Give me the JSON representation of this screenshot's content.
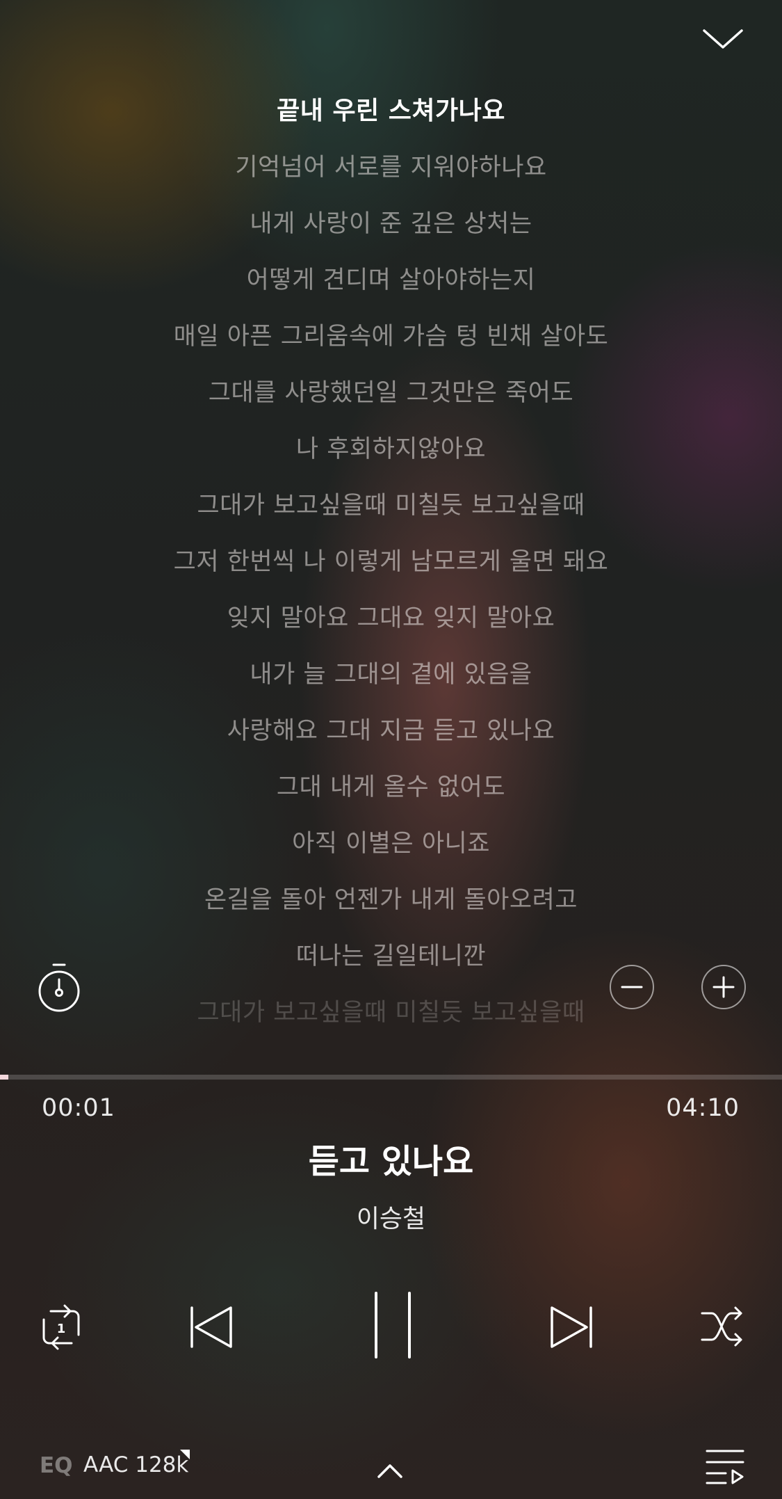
{
  "icons": {
    "collapse": "chevron-down-icon",
    "timer": "stopwatch-icon",
    "font_smaller": "minus-circle-icon",
    "font_larger": "plus-circle-icon",
    "repeat": "repeat-one-icon",
    "previous": "skip-previous-icon",
    "pause": "pause-icon",
    "next": "skip-next-icon",
    "shuffle": "shuffle-icon",
    "expand": "chevron-up-icon",
    "playlist": "playlist-icon"
  },
  "lyrics": {
    "lines": [
      "끝내 우린 스쳐가나요",
      "기억넘어 서로를 지워야하나요",
      "내게 사랑이 준 깊은 상처는",
      "어떻게 견디며 살아야하는지",
      "매일 아픈 그리움속에 가슴 텅 빈채 살아도",
      "그대를 사랑했던일 그것만은 죽어도",
      "나 후회하지않아요",
      "그대가 보고싶을때 미칠듯 보고싶을때",
      "그저 한번씩 나 이렇게 남모르게 울면 돼요",
      "잊지 말아요 그대요 잊지 말아요",
      "내가 늘 그대의 곁에 있음을",
      "사랑해요 그대 지금 듣고 있나요",
      "그대 내게 올수 없어도",
      "아직 이별은 아니죠",
      "온길을 돌아 언젠가 내게 돌아오려고",
      "떠나는 길일테니깐",
      "그대가 보고싶을때 미칠듯 보고싶을때"
    ],
    "current_index": 0
  },
  "player": {
    "elapsed": "00:01",
    "total": "04:10",
    "progress": 0.004,
    "title": "듣고 있나요",
    "artist": "이승철",
    "repeat_mode_label": "1",
    "eq_label": "EQ",
    "codec": "AAC 128k"
  },
  "colors": {
    "progress_fill": "#f3d7dc",
    "progress_track": "rgba(255,255,255,0.18)"
  }
}
